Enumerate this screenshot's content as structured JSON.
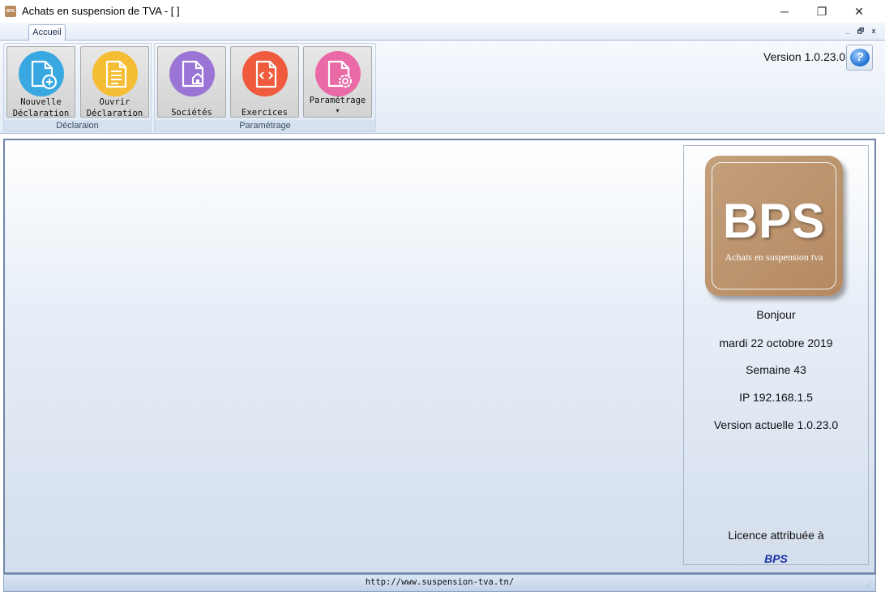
{
  "window": {
    "title": "Achats en suspension de TVA - [ ]",
    "app_icon_text": "BPS",
    "minimize": "─",
    "restore": "❐",
    "close": "✕"
  },
  "ribbon": {
    "tab": "Accueil",
    "mdi": {
      "minimize": "_",
      "restore": "🗗",
      "close": "x"
    },
    "groups": [
      {
        "label": "Déclaraion",
        "buttons": [
          {
            "line1": "Nouvelle",
            "line2": "Déclaration",
            "icon": "new-document-icon",
            "color": "#3aa8e0"
          },
          {
            "line1": "Ouvrir",
            "line2": "Déclaration",
            "icon": "open-document-icon",
            "color": "#f5bd33"
          }
        ]
      },
      {
        "label": "Paramétrage",
        "buttons": [
          {
            "line1": "Sociétés",
            "icon": "company-document-icon",
            "color": "#9b75d6"
          },
          {
            "line1": "Exercices",
            "icon": "code-document-icon",
            "color": "#ef5b3c"
          },
          {
            "line1": "Paramétrage",
            "icon": "settings-document-icon",
            "color": "#ea6aa7",
            "dropdown_arrow": "▾"
          }
        ]
      }
    ],
    "version_label": "Version 1.0.23.0",
    "help_glyph": "?"
  },
  "side_panel": {
    "logo": {
      "title": "BPS",
      "subtitle": "Achats en suspension tva",
      "color": "#c09a74"
    },
    "greeting": "Bonjour",
    "date": "mardi 22 octobre 2019",
    "week": "Semaine 43",
    "ip": "IP 192.168.1.5",
    "current_version": "Version actuelle 1.0.23.0",
    "license_label": "Licence attribuée à",
    "license_owner": "BPS"
  },
  "status_bar": {
    "url": "http://www.suspension-tva.tn/",
    "grip": "⋰"
  }
}
